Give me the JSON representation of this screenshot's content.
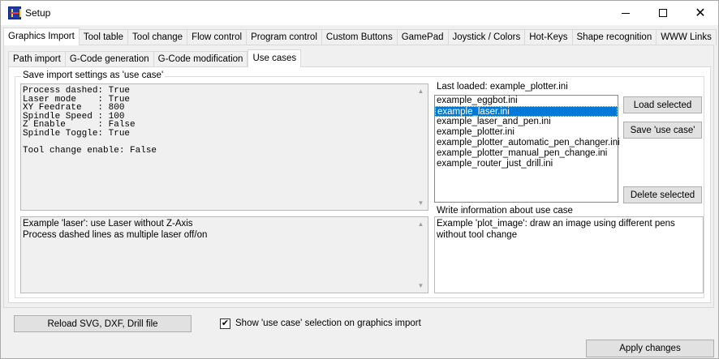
{
  "window": {
    "title": "Setup"
  },
  "main_tabs": [
    "Graphics Import",
    "Tool table",
    "Tool change",
    "Flow control",
    "Program control",
    "Custom Buttons",
    "GamePad",
    "Joystick / Colors",
    "Hot-Keys",
    "Shape recognition",
    "WWW Links"
  ],
  "sub_tabs": [
    "Path import",
    "G-Code generation",
    "G-Code modification",
    "Use cases"
  ],
  "use_case": {
    "group_label": "Save import settings as 'use case'",
    "settings_text": "Process dashed: True\nLaser mode    : True\nXY Feedrate   : 800\nSpindle Speed : 100\nZ Enable      : False\nSpindle Toggle: True\n\nTool change enable: False",
    "description_text": "Example 'laser': use Laser without Z-Axis\nProcess dashed lines as multiple laser off/on",
    "last_loaded_label": "Last loaded:  example_plotter.ini",
    "files": [
      "example_eggbot.ini",
      "example_laser.ini",
      "example_laser_and_pen.ini",
      "example_plotter.ini",
      "example_plotter_automatic_pen_changer.ini",
      "example_plotter_manual_pen_change.ini",
      "example_router_just_drill.ini"
    ],
    "selected_file": "example_laser.ini",
    "load_button": "Load selected",
    "save_button": "Save 'use case'",
    "delete_button": "Delete selected",
    "write_info_label": "Write information about use case",
    "write_info_text": "Example 'plot_image': draw an image using different pens without tool change"
  },
  "reload_button": "Reload SVG, DXF, Drill file",
  "show_checkbox": {
    "label": "Show 'use case' selection on graphics import",
    "checked": true
  },
  "apply_button": "Apply changes"
}
